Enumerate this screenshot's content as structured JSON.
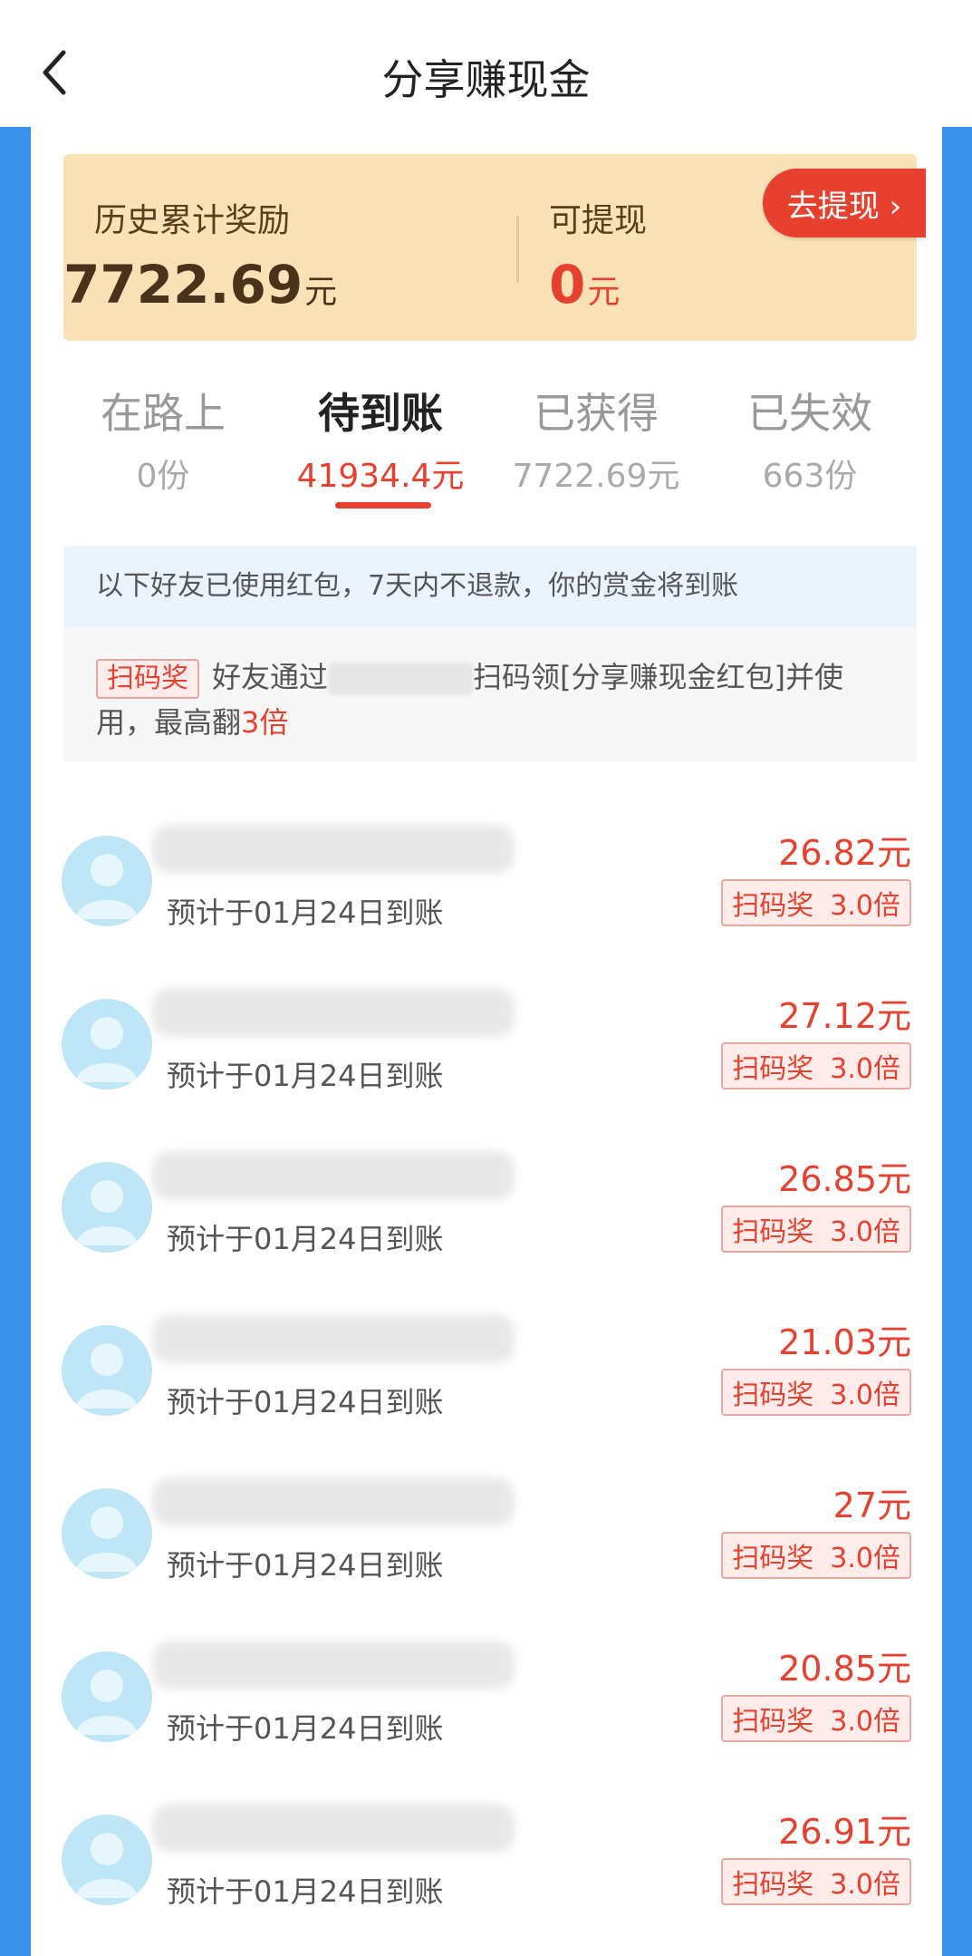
{
  "header": {
    "title": "分享赚现金"
  },
  "reward": {
    "total_label": "历史累计奖励",
    "total_amount": "7722.69",
    "withdrawable_label": "可提现",
    "withdrawable_amount": "0",
    "unit": "元",
    "withdraw_button": "去提现 ›"
  },
  "tabs": [
    {
      "label": "在路上",
      "value": "0份"
    },
    {
      "label": "待到账",
      "value": "41934.4元"
    },
    {
      "label": "已获得",
      "value": "7722.69元"
    },
    {
      "label": "已失效",
      "value": "663份"
    }
  ],
  "notice": "以下好友已使用红包，7天内不退款，你的赏金将到账",
  "promo": {
    "tag": "扫码奖",
    "text_before": "好友通过",
    "text_after": "扫码领[分享赚现金红包]并使",
    "line2_before": "用，最高翻",
    "highlight": "3倍"
  },
  "items": [
    {
      "eta": "预计于01月24日到账",
      "amount": "26.82元",
      "tag": "扫码奖",
      "multiplier": "3.0倍"
    },
    {
      "eta": "预计于01月24日到账",
      "amount": "27.12元",
      "tag": "扫码奖",
      "multiplier": "3.0倍"
    },
    {
      "eta": "预计于01月24日到账",
      "amount": "26.85元",
      "tag": "扫码奖",
      "multiplier": "3.0倍"
    },
    {
      "eta": "预计于01月24日到账",
      "amount": "21.03元",
      "tag": "扫码奖",
      "multiplier": "3.0倍"
    },
    {
      "eta": "预计于01月24日到账",
      "amount": "27元",
      "tag": "扫码奖",
      "multiplier": "3.0倍"
    },
    {
      "eta": "预计于01月24日到账",
      "amount": "20.85元",
      "tag": "扫码奖",
      "multiplier": "3.0倍"
    },
    {
      "eta": "预计于01月24日到账",
      "amount": "26.91元",
      "tag": "扫码奖",
      "multiplier": "3.0倍"
    }
  ],
  "colors": {
    "accent": "#e8402f",
    "page_bg": "#3a93ea",
    "card_bg": "#fbe2b6"
  }
}
